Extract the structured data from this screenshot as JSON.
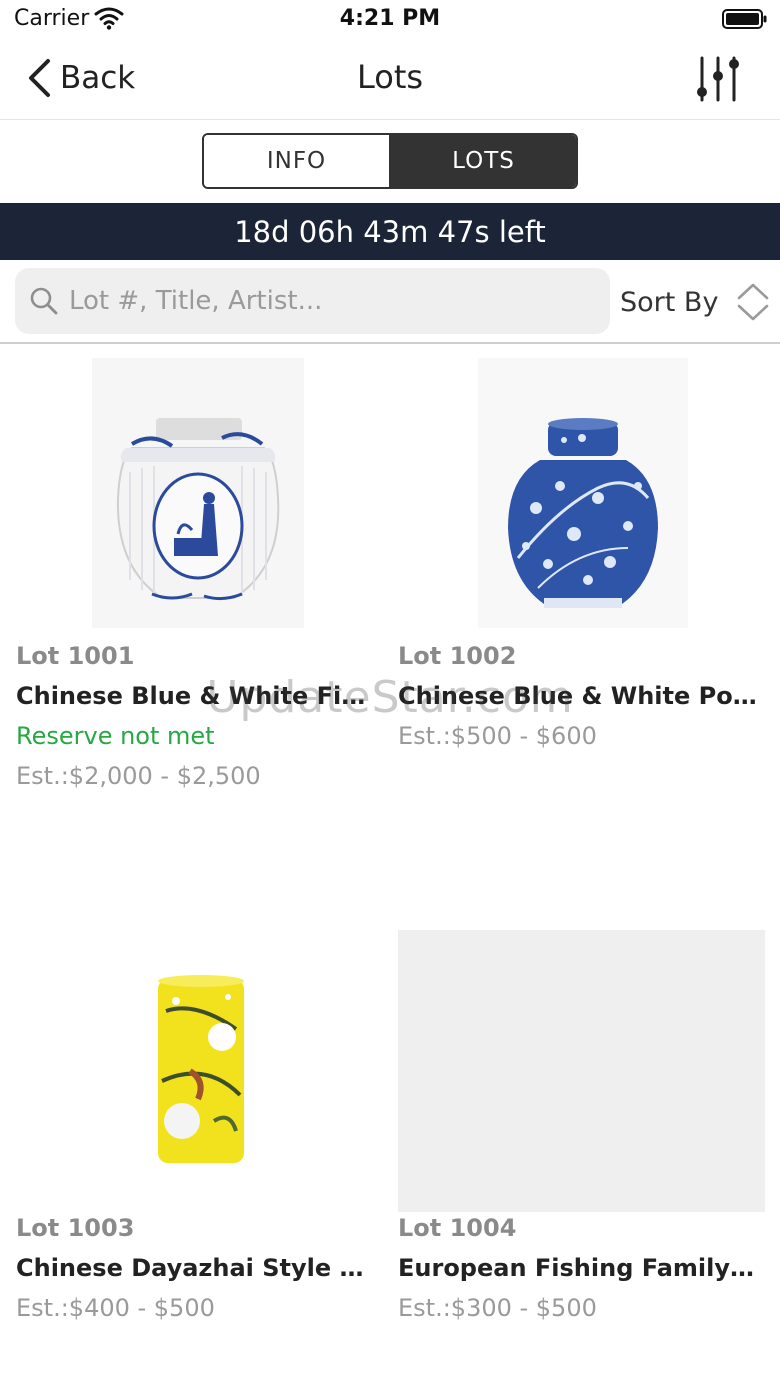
{
  "status_bar": {
    "carrier": "Carrier",
    "time": "4:21 PM"
  },
  "nav": {
    "back_label": "Back",
    "title": "Lots",
    "filter_icon": "sliders-icon"
  },
  "segments": {
    "info": "INFO",
    "lots": "LOTS",
    "selected": "LOTS"
  },
  "countdown": "18d 06h 43m 47s left",
  "search": {
    "placeholder": "Lot #, Title, Artist..."
  },
  "sort": {
    "label": "Sort By"
  },
  "lots": [
    {
      "lot_number": "Lot 1001",
      "title": "Chinese Blue & White Figure...",
      "reserve": "Reserve not met",
      "estimate": "Est.:$2,000 - $2,500"
    },
    {
      "lot_number": "Lot 1002",
      "title": "Chinese Blue & White Porc...",
      "estimate": "Est.:$500 - $600"
    },
    {
      "lot_number": "Lot 1003",
      "title": "Chinese Dayazhai Style Bru...",
      "estimate": "Est.:$400 - $500"
    },
    {
      "lot_number": "Lot 1004",
      "title": "European Fishing Family M...",
      "estimate": "Est.:$300 - $500"
    }
  ],
  "watermark": "UpdateStar.com",
  "colors": {
    "countdown_bg": "#1b2537",
    "segment_selected": "#333333",
    "reserve_text": "#27a844",
    "search_bg": "#efefef"
  }
}
